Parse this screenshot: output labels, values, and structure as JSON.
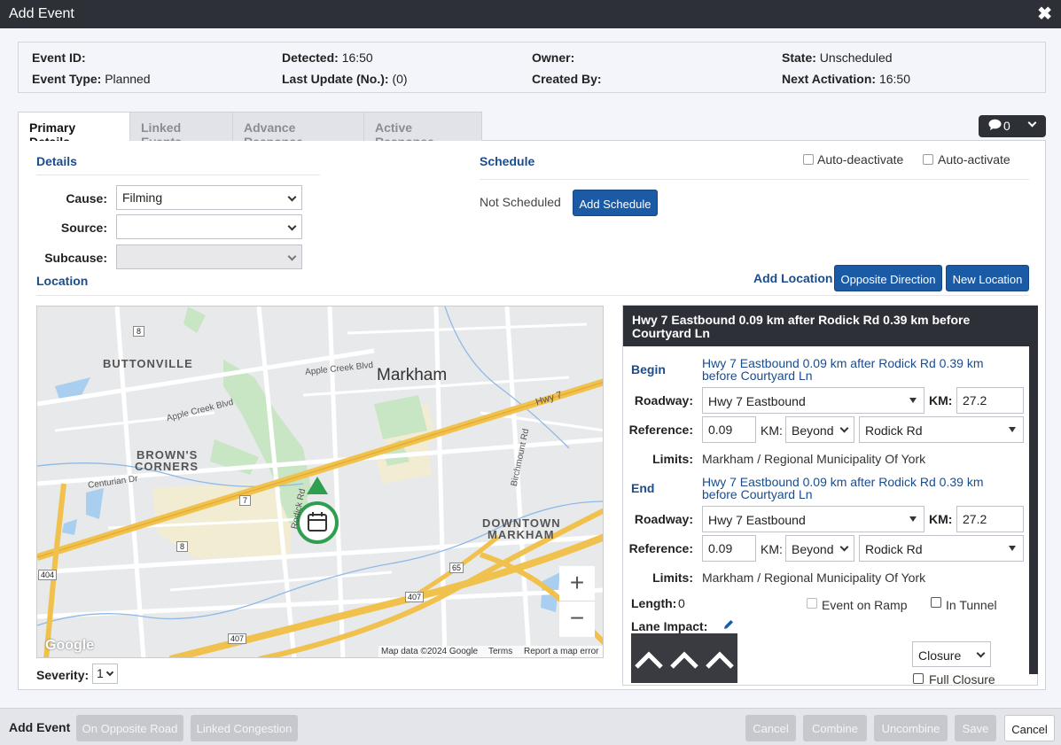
{
  "window": {
    "title": "Add Event"
  },
  "info": {
    "event_id_label": "Event ID:",
    "event_id_value": "",
    "event_type_label": "Event Type:",
    "event_type_value": "Planned",
    "detected_label": "Detected:",
    "detected_value": "16:50",
    "last_update_label": "Last Update (No.):",
    "last_update_value": "(0)",
    "owner_label": "Owner:",
    "owner_value": "",
    "created_by_label": "Created By:",
    "created_by_value": "",
    "state_label": "State:",
    "state_value": "Unscheduled",
    "next_activation_label": "Next Activation:",
    "next_activation_value": "16:50"
  },
  "tabs": [
    {
      "label": "Primary Details",
      "active": true
    },
    {
      "label": "Linked Events"
    },
    {
      "label": "Advance Response"
    },
    {
      "label": "Active Response"
    }
  ],
  "chat": {
    "count": "0"
  },
  "details": {
    "heading": "Details",
    "cause_label": "Cause:",
    "cause_value": "Filming",
    "source_label": "Source:",
    "source_value": "",
    "subcause_label": "Subcause:",
    "subcause_value": ""
  },
  "schedule": {
    "heading": "Schedule",
    "auto_deactivate": "Auto-deactivate",
    "auto_activate": "Auto-activate",
    "status": "Not Scheduled",
    "add_button": "Add Schedule"
  },
  "location": {
    "heading": "Location",
    "add_location": "Add Location",
    "opposite_direction": "Opposite Direction",
    "new_location": "New Location"
  },
  "map": {
    "labels": {
      "buttonville": "BUTTONVILLE",
      "markham": "Markham",
      "browns_corners_1": "BROWN'S",
      "browns_corners_2": "CORNERS",
      "downtown_1": "DOWNTOWN",
      "downtown_2": "MARKHAM",
      "apple_creek_1": "Apple Creek Blvd",
      "apple_creek_2": "Apple Creek Blvd",
      "hwy7": "Hwy 7",
      "birchmount": "Birchmount Rd",
      "rodick": "Rodick Rd",
      "centurian": "Centurian Dr",
      "shield_8a": "8",
      "shield_8b": "8",
      "shield_7": "7",
      "shield_404": "404",
      "shield_65": "65",
      "shield_407a": "407",
      "shield_407b": "407"
    },
    "attribution": "Map data ©2024 Google",
    "terms": "Terms",
    "report": "Report a map error",
    "logo": "Google",
    "zoom_in": "+",
    "zoom_out": "−"
  },
  "severity": {
    "label": "Severity:",
    "value": "1"
  },
  "panel": {
    "title": "Hwy 7 Eastbound 0.09 km after Rodick Rd 0.39 km before Courtyard Ln",
    "begin_label": "Begin",
    "begin_desc": "Hwy 7 Eastbound 0.09 km after Rodick Rd 0.39 km before Courtyard Ln",
    "end_label": "End",
    "end_desc": "Hwy 7 Eastbound 0.09 km after Rodick Rd 0.39 km before Courtyard Ln",
    "roadway_label": "Roadway:",
    "roadway_value": "Hwy 7 Eastbound",
    "km_label": "KM:",
    "km_value": "27.2",
    "end_km_value": "27.2",
    "reference_label": "Reference:",
    "ref_offset": "0.09",
    "km_unit": "KM:",
    "ref_relation": "Beyond",
    "ref_road": "Rodick Rd",
    "limits_label": "Limits:",
    "limits_value": "Markham / Regional Municipality Of York",
    "length_label": "Length:",
    "length_value": "0",
    "event_on_ramp": "Event on Ramp",
    "in_tunnel": "In Tunnel",
    "lane_impact_label": "Lane Impact:",
    "closure_value": "Closure",
    "full_closure": "Full Closure"
  },
  "footer": {
    "label": "Add Event",
    "on_opposite_road": "On Opposite Road",
    "linked_congestion": "Linked Congestion",
    "cancel_disabled": "Cancel",
    "combine": "Combine",
    "uncombine": "Uncombine",
    "save": "Save",
    "cancel": "Cancel"
  }
}
